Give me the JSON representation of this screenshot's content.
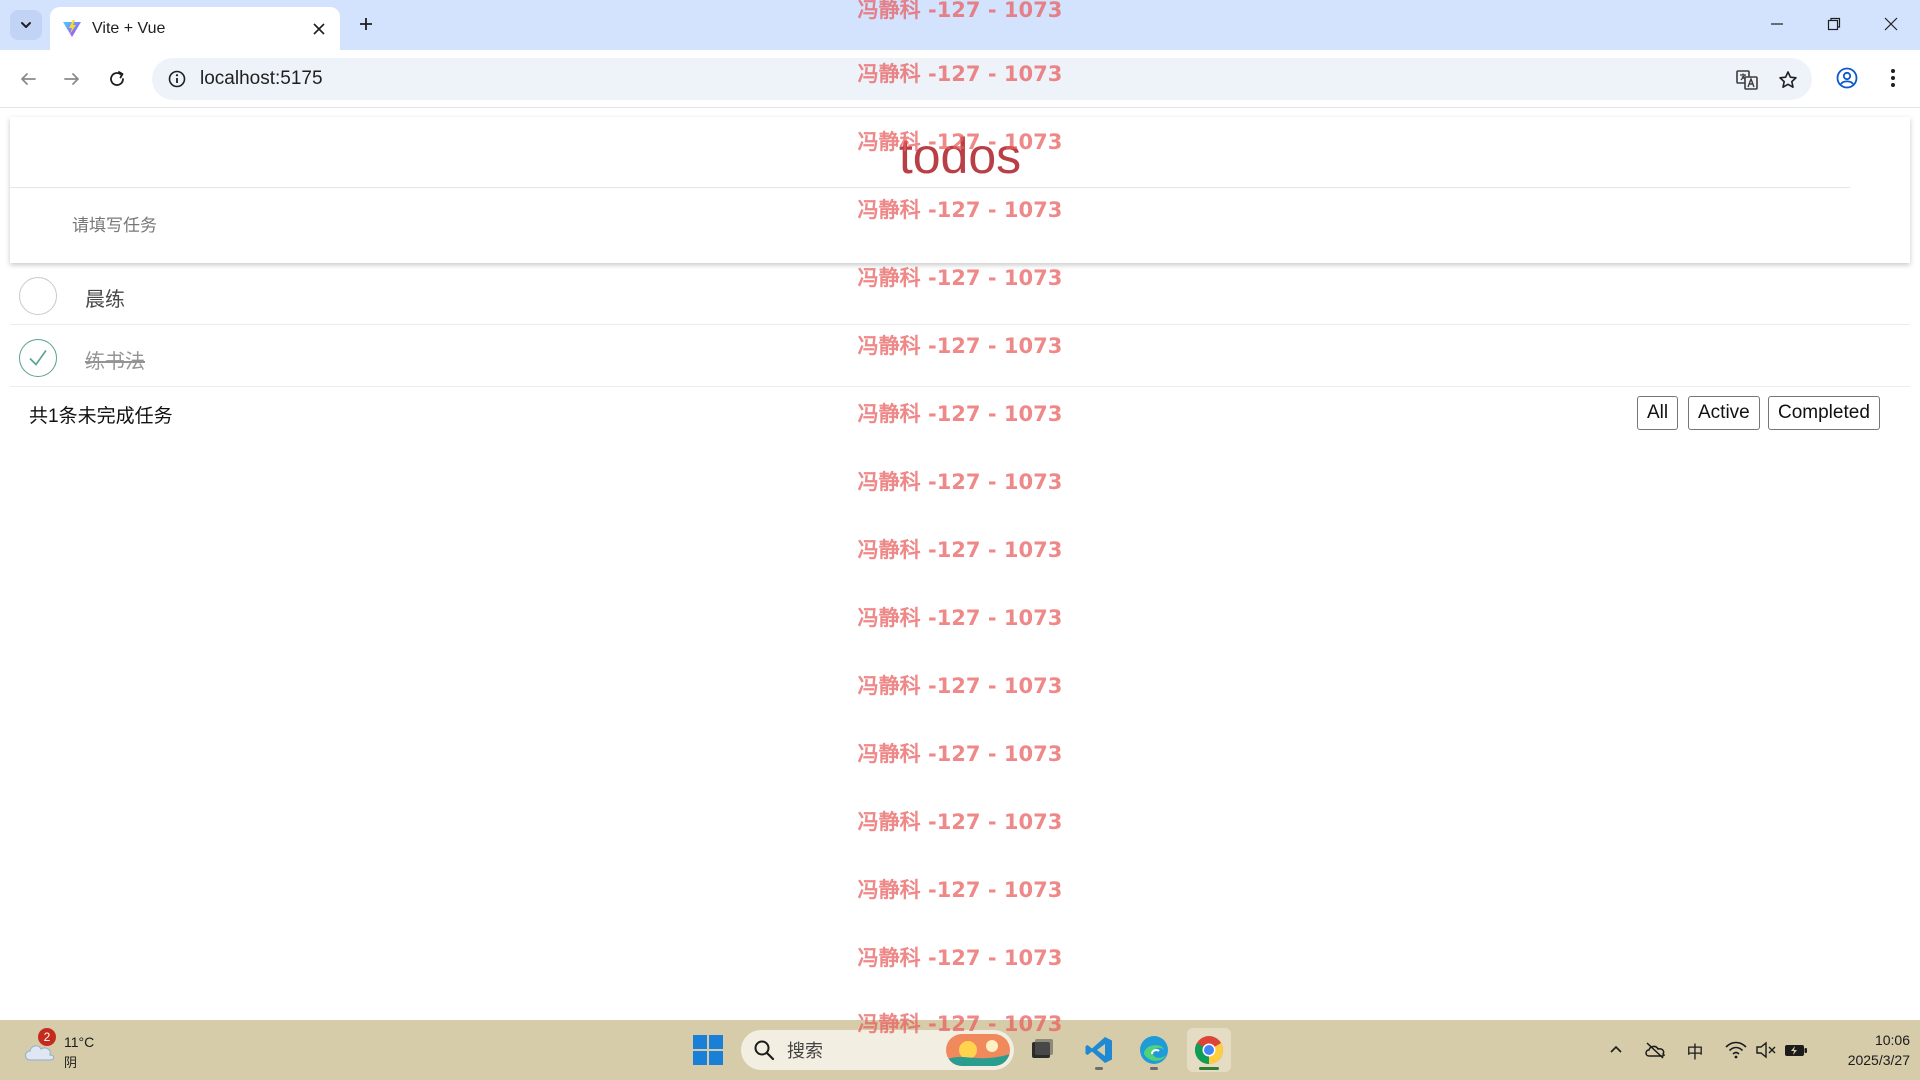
{
  "browser": {
    "tab_title": "Vite + Vue",
    "url": "localhost:5175"
  },
  "app": {
    "title": "todos",
    "new_todo_placeholder": "请填写任务",
    "todos": [
      {
        "label": "晨练",
        "completed": false
      },
      {
        "label": "练书法",
        "completed": true
      }
    ],
    "count_text": "共1条未完成任务",
    "filters": [
      "All",
      "Active",
      "Completed"
    ]
  },
  "watermark": {
    "text": "冯静科 -127 - 1073"
  },
  "taskbar": {
    "weather_badge": "2",
    "weather_temp": "11°C",
    "weather_cond": "阴",
    "search_label": "搜索",
    "ime": "中",
    "time": "10:06",
    "date": "2025/3/27"
  }
}
